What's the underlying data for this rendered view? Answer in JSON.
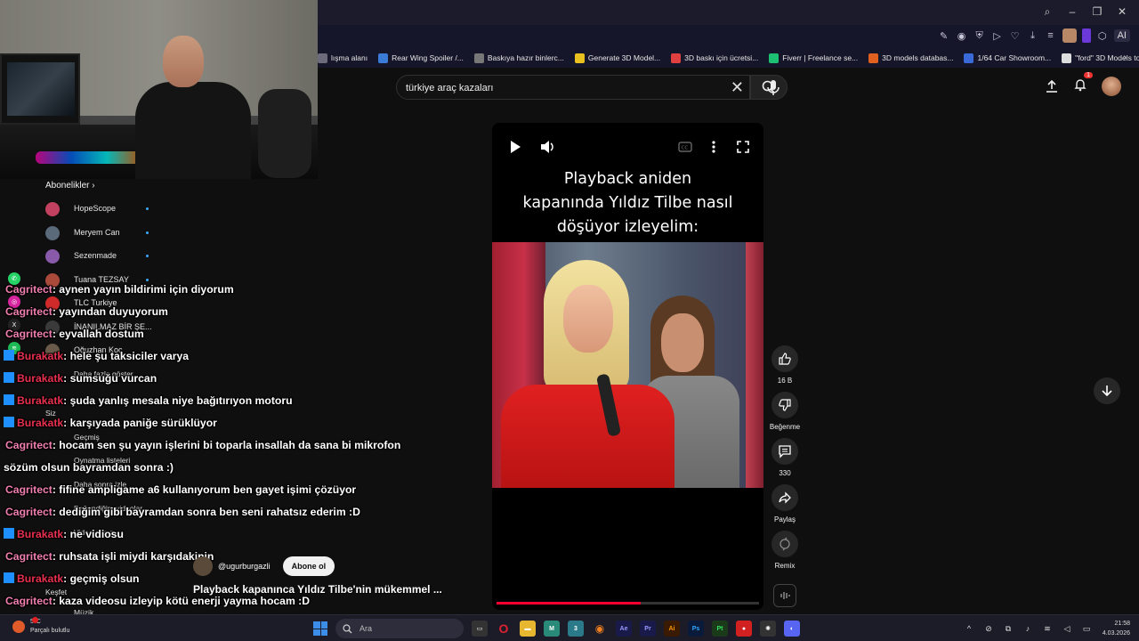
{
  "browser": {
    "ai_label": "AI",
    "bookmarks": [
      {
        "label": "lışma alanı",
        "color": "#6b6b7b"
      },
      {
        "label": "Rear Wing Spoiler /...",
        "color": "#3a7bd5"
      },
      {
        "label": "Baskıya hazır binlerc...",
        "color": "#777777"
      },
      {
        "label": "Generate 3D Model...",
        "color": "#e8c020"
      },
      {
        "label": "3D baskı için ücretsi...",
        "color": "#e04040"
      },
      {
        "label": "Fiverr | Freelance se...",
        "color": "#1dbf73"
      },
      {
        "label": "3D models databas...",
        "color": "#e06020"
      },
      {
        "label": "1/64 Car Showroom...",
        "color": "#3a6ad8"
      },
      {
        "label": "\"ford\" 3D Models to...",
        "color": "#dddddd"
      }
    ]
  },
  "youtube": {
    "search_value": "türkiye araç kazaları",
    "notification_count": "1"
  },
  "sidebar": {
    "subscriptions_title": "Abonelikler",
    "subs": [
      {
        "name": "HopeScope",
        "color": "#c24060"
      },
      {
        "name": "Meryem Can",
        "color": "#5a6a7a"
      },
      {
        "name": "Sezenmade",
        "color": "#8a5aaa"
      },
      {
        "name": "Tuana TEZSAY",
        "color": "#aa4a3a"
      },
      {
        "name": "TLC Turkiye",
        "color": "#d02a2a"
      },
      {
        "name": "İNANILMAZ BİR ŞE...",
        "color": "#3a3a3a"
      },
      {
        "name": "Oğuzhan Koç",
        "color": "#6a5a4a"
      }
    ],
    "show_more": "Daha fazla göster",
    "you_title": "Siz",
    "you_items": [
      "Geçmiş",
      "Oynatma listeleri",
      "Daha sonra izle",
      "Beğendiğim videolar",
      "Videolarınız"
    ],
    "explore_title": "Keşfet",
    "explore_first": "Müzik"
  },
  "chat": [
    {
      "user": "Cagritect",
      "type": "cag",
      "msg": ": aynen yayın bildirimi için diyorum"
    },
    {
      "user": "Cagritect",
      "type": "cag",
      "msg": ": yayından duyuyorum"
    },
    {
      "user": "Cagritect",
      "type": "cag",
      "msg": ": eyvallah dostum"
    },
    {
      "user": "Burakatk",
      "type": "bur",
      "msg": ": hele şu taksiciler varya"
    },
    {
      "user": "Burakatk",
      "type": "bur",
      "msg": ": sumsuğu vurcan"
    },
    {
      "user": "Burakatk",
      "type": "bur",
      "msg": ": şuda yanlış mesala niye bağıtırıyon motoru"
    },
    {
      "user": "Burakatk",
      "type": "bur",
      "msg": ": karşıyada paniğe sürüklüyor"
    },
    {
      "user": "Cagritect",
      "type": "cag",
      "msg": ": hocam sen şu yayın işlerini bi toparla insallah da sana bi mikrofon"
    },
    {
      "user": "",
      "type": "cont",
      "msg": "sözüm olsun bayramdan sonra :)"
    },
    {
      "user": "Cagritect",
      "type": "cag",
      "msg": ": fifine ampligame a6 kullanıyorum ben gayet işimi çözüyor"
    },
    {
      "user": "Cagritect",
      "type": "cag",
      "msg": ": dediğim gibi bayramdan sonra ben seni rahatsız ederim :D"
    },
    {
      "user": "Burakatk",
      "type": "bur",
      "msg": ": ne vidiosu"
    },
    {
      "user": "Cagritect",
      "type": "cag",
      "msg": ": ruhsata işli miydi karşıdakinin"
    },
    {
      "user": "Burakatk",
      "type": "bur",
      "msg": ": geçmiş olsun"
    },
    {
      "user": "Cagritect",
      "type": "cag",
      "msg": ": kaza videosu izleyip kötü enerji yayma hocam :D"
    }
  ],
  "video": {
    "caption_line1": "Playback  aniden",
    "caption_line2": "kapanında  Yıldız Tilbe nasıl",
    "caption_line3": "döşüyor izleyelim:",
    "progress": 0.55,
    "channel": "@ugurburgazli",
    "subscribe": "Abone ol",
    "title": "Playback kapanınca Yıldız Tilbe'nin mükemmel ..."
  },
  "actions": {
    "like_count": "16 B",
    "dislike_label": "Beğenme",
    "comment_count": "330",
    "share_label": "Paylaş",
    "remix_label": "Remix"
  },
  "taskbar": {
    "temp": "5°C",
    "weather": "Parçalı bulutlu",
    "search": "Ara",
    "time": "21:58",
    "date": "4.03.2026"
  }
}
